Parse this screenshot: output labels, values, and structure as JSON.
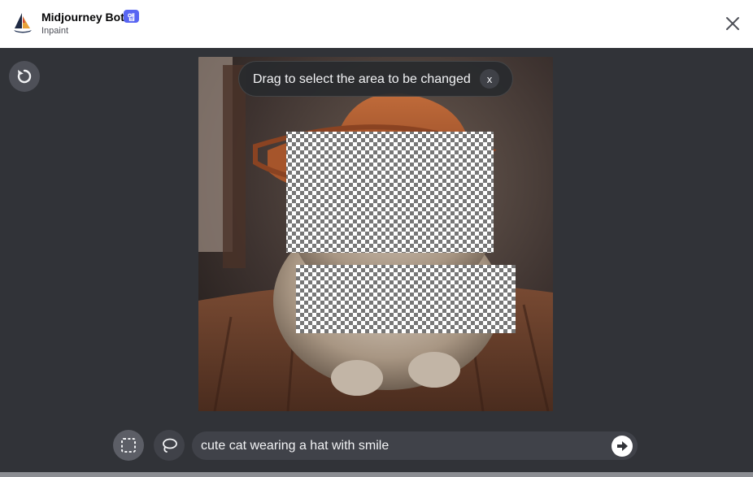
{
  "header": {
    "bot_name": "Midjourney Bot",
    "app_badge": "앱",
    "subtitle": "Inpaint",
    "badge_color": "#5865f2"
  },
  "editor": {
    "tooltip_text": "Drag to select the area to be changed",
    "tooltip_close_label": "x"
  },
  "toolbar": {
    "tools": [
      {
        "name": "rectangle-select-icon",
        "active": true
      },
      {
        "name": "lasso-select-icon",
        "active": false
      }
    ]
  },
  "prompt": {
    "value": "cute cat wearing a hat with smile"
  },
  "icons": {
    "reset": "undo-icon",
    "close": "close-icon",
    "send": "arrow-right-icon"
  },
  "colors": {
    "background": "#313338",
    "header": "#ffffff",
    "input": "#404249"
  }
}
